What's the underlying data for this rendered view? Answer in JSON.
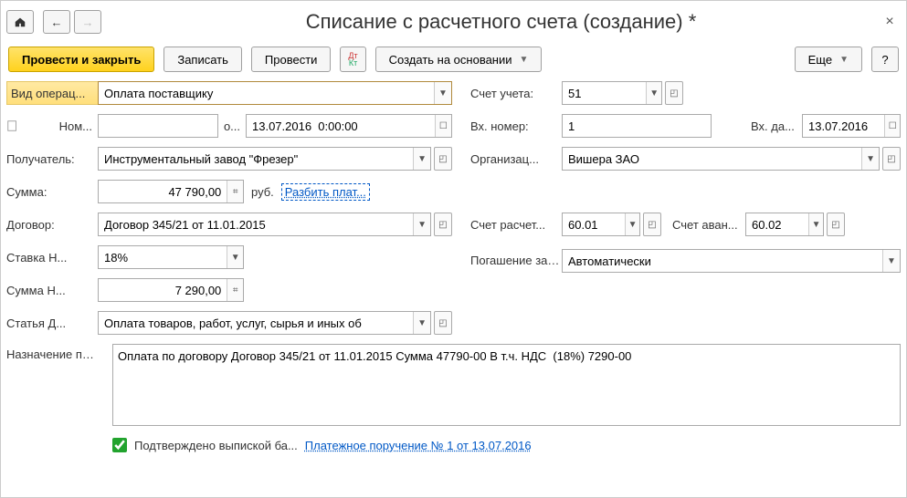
{
  "header": {
    "title": "Списание с расчетного счета (создание) *"
  },
  "toolbar": {
    "postClose": "Провести и закрыть",
    "save": "Записать",
    "post": "Провести",
    "createBased": "Создать на основании",
    "more": "Еще"
  },
  "labels": {
    "opType": "Вид операц...",
    "number": "Ном...",
    "from": "о...",
    "recipient": "Получатель:",
    "sum": "Сумма:",
    "rub": "руб.",
    "split": "Разбить плат...",
    "contract": "Договор:",
    "vatRate": "Ставка Н...",
    "vatSum": "Сумма Н...",
    "cashItem": "Статья Д...",
    "purpose": "Назначение платежа:",
    "account": "Счет учета:",
    "incNum": "Вх. номер:",
    "incDate": "Вх. да...",
    "org": "Организац...",
    "acctSettle": "Счет расчет...",
    "acctAdv": "Счет аван...",
    "repay": "Погашение задолженно...",
    "confirmed": "Подтверждено выпиской ба...",
    "paymentLink": "Платежное поручение № 1 от 13.07.2016"
  },
  "values": {
    "opType": "Оплата поставщику",
    "number": "",
    "date": "13.07.2016  0:00:00",
    "recipient": "Инструментальный завод \"Фрезер\"",
    "sum": "47 790,00",
    "contract": "Договор 345/21 от 11.01.2015",
    "vatRate": "18%",
    "vatSum": "7 290,00",
    "cashItem": "Оплата товаров, работ, услуг, сырья и иных об",
    "purpose": "Оплата по договору Договор 345/21 от 11.01.2015 Сумма 47790-00 В т.ч. НДС  (18%) 7290-00",
    "account": "51",
    "incNum": "1",
    "incDate": "13.07.2016",
    "org": "Вишера ЗАО",
    "acctSettle": "60.01",
    "acctAdv": "60.02",
    "repay": "Автоматически"
  }
}
